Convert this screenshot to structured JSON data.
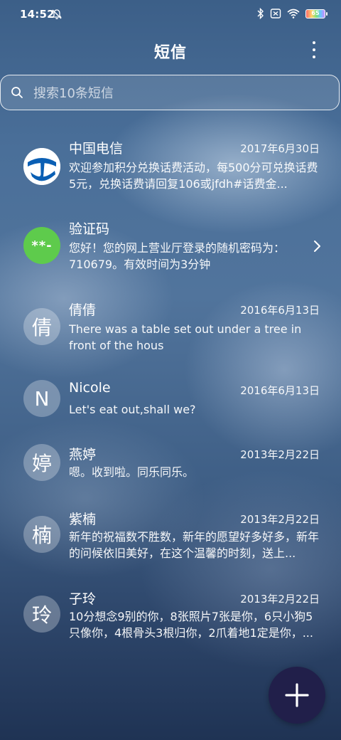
{
  "status_bar": {
    "time": "14:52",
    "battery_level": "65"
  },
  "header": {
    "title": "短信"
  },
  "search": {
    "placeholder": "搜索10条短信"
  },
  "conversations": [
    {
      "name": "中国电信",
      "date": "2017年6月30日",
      "preview": "欢迎参加积分兑换话费活动，每500分可兑换话费5元，兑换话费请回复106或jfdh#话费金...",
      "avatar_type": "logo"
    },
    {
      "name": "验证码",
      "date": "",
      "preview": "您好！您的网上营业厅登录的随机密码为：710679。有效时间为3分钟",
      "avatar_text": "**-",
      "avatar_color": "#5ecb4c"
    },
    {
      "name": "倩倩",
      "date": "2016年6月13日",
      "preview": "There was a table set out under a tree in front of the hous",
      "avatar_text": "倩"
    },
    {
      "name": "Nicole",
      "date": "2016年6月13日",
      "preview": "Let's eat out,shall we?",
      "avatar_text": "N"
    },
    {
      "name": "燕婷",
      "date": "2013年2月22日",
      "preview": "嗯。收到啦。同乐同乐。",
      "avatar_text": "婷"
    },
    {
      "name": "紫楠",
      "date": "2013年2月22日",
      "preview": "新年的祝福数不胜数，新年的愿望好多好多，新年的问候依旧美好，在这个温馨的时刻，送上...",
      "avatar_text": "楠"
    },
    {
      "name": "子玲",
      "date": "2013年2月22日",
      "preview": "10分想念9别的你，8张照片7张是你，6只小狗5只像你，4根骨头3根归你，2爪着地1定是你，...",
      "avatar_text": "玲"
    }
  ],
  "icons": {
    "fab": "plus-icon",
    "more": "more-vert-icon",
    "search": "search-icon"
  },
  "colors": {
    "fab_background": "#211f4a",
    "code_avatar": "#5ecb4c",
    "telecom_blue": "#0a5fb4"
  }
}
